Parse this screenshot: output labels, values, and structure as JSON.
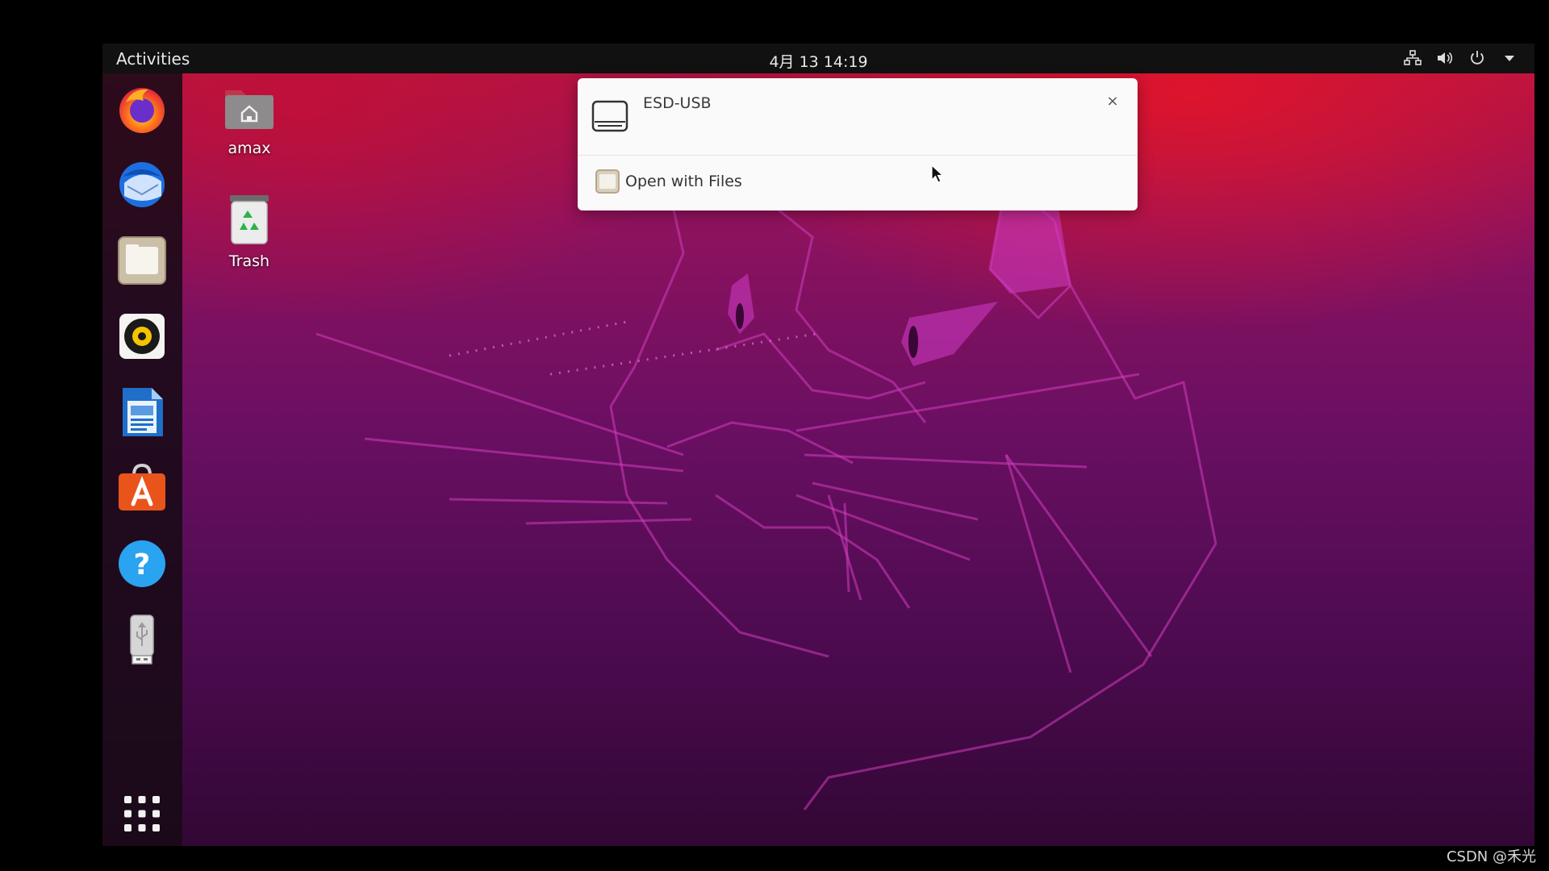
{
  "topbar": {
    "activities_label": "Activities",
    "clock": "4月 13  14:19",
    "tray_icons": [
      "network-wired-icon",
      "volume-icon",
      "power-icon",
      "dropdown-arrow-icon"
    ]
  },
  "dock": {
    "items": [
      {
        "name": "Firefox Web Browser",
        "icon": "firefox-icon"
      },
      {
        "name": "Thunderbird Mail",
        "icon": "thunderbird-icon"
      },
      {
        "name": "Files",
        "icon": "files-icon"
      },
      {
        "name": "Rhythmbox",
        "icon": "rhythmbox-icon"
      },
      {
        "name": "LibreOffice Writer",
        "icon": "libreoffice-writer-icon"
      },
      {
        "name": "Ubuntu Software",
        "icon": "ubuntu-software-icon"
      },
      {
        "name": "Help",
        "icon": "help-icon"
      },
      {
        "name": "USB Drive",
        "icon": "usb-drive-icon"
      }
    ],
    "show_apps_icon": "app-grid-icon"
  },
  "desktop": {
    "icons": [
      {
        "label": "amax",
        "icon": "home-folder-icon"
      },
      {
        "label": "Trash",
        "icon": "trash-icon"
      }
    ]
  },
  "notification": {
    "title": "ESD-USB",
    "close_symbol": "×",
    "action_label": "Open with Files",
    "icon": "drive-icon"
  },
  "watermark": "CSDN @禾光",
  "colors": {
    "topbar_bg": "#111111",
    "dock_bg": "#180a16",
    "wallpaper_top": "#b81440",
    "wallpaper_bottom": "#320735",
    "notification_bg": "#fafafa"
  }
}
